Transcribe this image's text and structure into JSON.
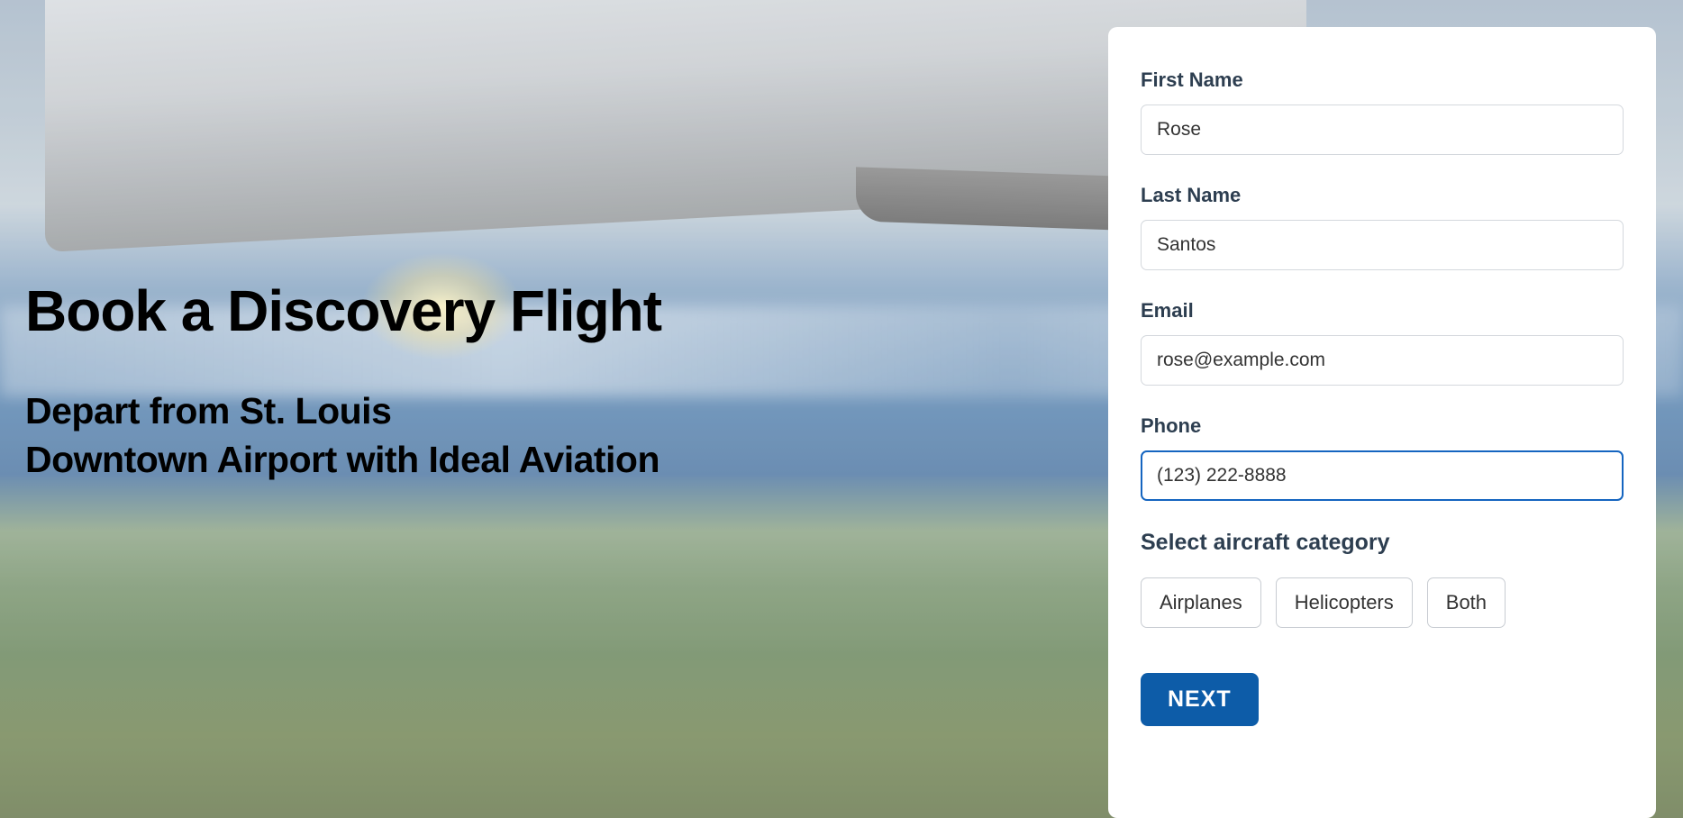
{
  "hero": {
    "title": "Book a Discovery Flight",
    "subtitle_line1": "Depart from St. Louis",
    "subtitle_line2": "Downtown Airport with Ideal Aviation"
  },
  "form": {
    "first_name": {
      "label": "First Name",
      "value": "Rose"
    },
    "last_name": {
      "label": "Last Name",
      "value": "Santos"
    },
    "email": {
      "label": "Email",
      "value": "rose@example.com"
    },
    "phone": {
      "label": "Phone",
      "value": "(123) 222-8888"
    },
    "aircraft_category": {
      "label": "Select aircraft category",
      "options": [
        "Airplanes",
        "Helicopters",
        "Both"
      ]
    },
    "next_button": "NEXT"
  }
}
